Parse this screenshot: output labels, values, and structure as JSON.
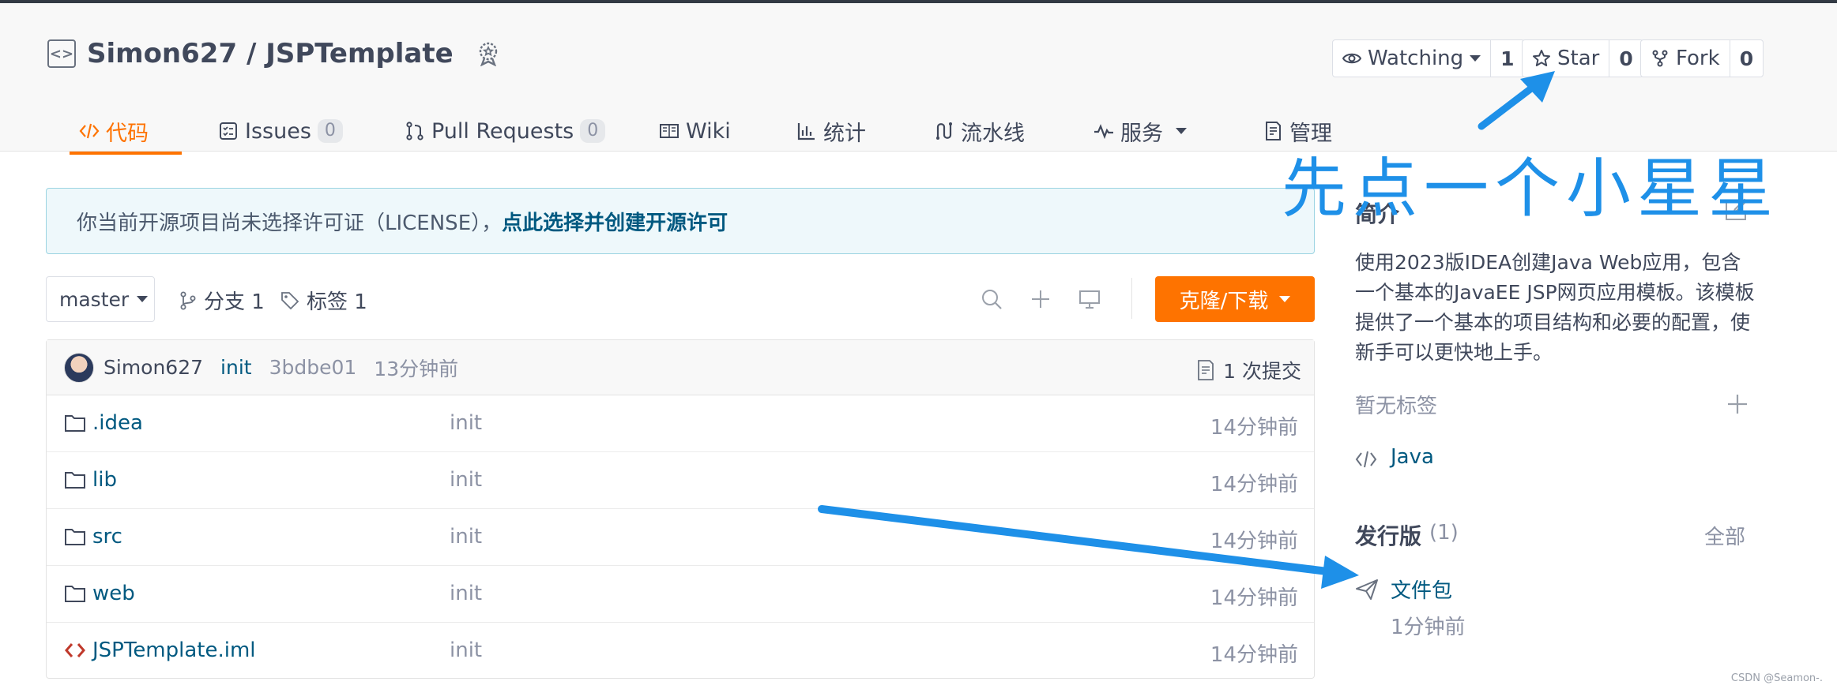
{
  "repo": {
    "owner": "Simon627",
    "separator": " / ",
    "name": "JSPTemplate"
  },
  "actions": {
    "watch": {
      "label": "Watching",
      "count": "1"
    },
    "star": {
      "label": "Star",
      "count": "0"
    },
    "fork": {
      "label": "Fork",
      "count": "0"
    }
  },
  "tabs": [
    {
      "label": "代码",
      "icon": "code-icon",
      "active": true
    },
    {
      "label": "Issues",
      "count": "0",
      "icon": "issues-icon"
    },
    {
      "label": "Pull Requests",
      "count": "0",
      "icon": "pull-request-icon"
    },
    {
      "label": "Wiki",
      "icon": "book-icon"
    },
    {
      "label": "统计",
      "icon": "bar-chart-icon"
    },
    {
      "label": "流水线",
      "icon": "pipeline-icon"
    },
    {
      "label": "服务",
      "icon": "activity-icon"
    },
    {
      "label": "管理",
      "icon": "settings-doc-icon"
    }
  ],
  "license": {
    "text": "你当前开源项目尚未选择许可证（LICENSE），",
    "link": "点此选择并创建开源许可"
  },
  "branch": {
    "current": "master",
    "branches_label": "分支 1",
    "tags_label": "标签 1",
    "clone_label": "克隆/下载"
  },
  "commit": {
    "author": "Simon627",
    "message": "init",
    "sha": "3bdbe01",
    "time": "13分钟前",
    "count_label": "1 次提交"
  },
  "files": [
    {
      "name": ".idea",
      "type": "folder",
      "message": "init",
      "time": "14分钟前"
    },
    {
      "name": "lib",
      "type": "folder",
      "message": "init",
      "time": "14分钟前"
    },
    {
      "name": "src",
      "type": "folder",
      "message": "init",
      "time": "14分钟前"
    },
    {
      "name": "web",
      "type": "folder",
      "message": "init",
      "time": "14分钟前"
    },
    {
      "name": "JSPTemplate.iml",
      "type": "code-file",
      "message": "init",
      "time": "14分钟前"
    }
  ],
  "sidebar": {
    "intro_title": "简介",
    "description": "使用2023版IDEA创建Java Web应用，包含一个基本的JavaEE JSP网页应用模板。该模板提供了一个基本的项目结构和必要的配置，使新手可以更快地上手。",
    "no_tags": "暂无标签",
    "language": "Java",
    "releases_title": "发行版",
    "releases_count": "(1)",
    "releases_all": "全部",
    "release_name": "文件包",
    "release_time": "1分钟前"
  },
  "annotation": "先点一个小星星",
  "watermark": "CSDN @Seamon-.",
  "colors": {
    "accent": "#fe7300",
    "link": "#005980",
    "annotation": "#1e90e8",
    "license_border": "#9bd4e2"
  }
}
